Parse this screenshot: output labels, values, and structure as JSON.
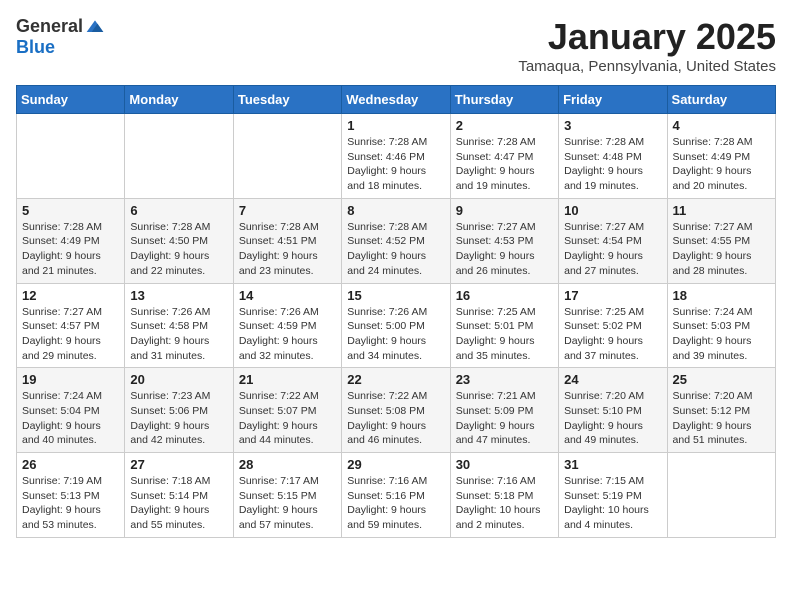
{
  "header": {
    "logo_general": "General",
    "logo_blue": "Blue",
    "month": "January 2025",
    "location": "Tamaqua, Pennsylvania, United States"
  },
  "weekdays": [
    "Sunday",
    "Monday",
    "Tuesday",
    "Wednesday",
    "Thursday",
    "Friday",
    "Saturday"
  ],
  "weeks": [
    [
      {
        "day": "",
        "info": ""
      },
      {
        "day": "",
        "info": ""
      },
      {
        "day": "",
        "info": ""
      },
      {
        "day": "1",
        "info": "Sunrise: 7:28 AM\nSunset: 4:46 PM\nDaylight: 9 hours\nand 18 minutes."
      },
      {
        "day": "2",
        "info": "Sunrise: 7:28 AM\nSunset: 4:47 PM\nDaylight: 9 hours\nand 19 minutes."
      },
      {
        "day": "3",
        "info": "Sunrise: 7:28 AM\nSunset: 4:48 PM\nDaylight: 9 hours\nand 19 minutes."
      },
      {
        "day": "4",
        "info": "Sunrise: 7:28 AM\nSunset: 4:49 PM\nDaylight: 9 hours\nand 20 minutes."
      }
    ],
    [
      {
        "day": "5",
        "info": "Sunrise: 7:28 AM\nSunset: 4:49 PM\nDaylight: 9 hours\nand 21 minutes."
      },
      {
        "day": "6",
        "info": "Sunrise: 7:28 AM\nSunset: 4:50 PM\nDaylight: 9 hours\nand 22 minutes."
      },
      {
        "day": "7",
        "info": "Sunrise: 7:28 AM\nSunset: 4:51 PM\nDaylight: 9 hours\nand 23 minutes."
      },
      {
        "day": "8",
        "info": "Sunrise: 7:28 AM\nSunset: 4:52 PM\nDaylight: 9 hours\nand 24 minutes."
      },
      {
        "day": "9",
        "info": "Sunrise: 7:27 AM\nSunset: 4:53 PM\nDaylight: 9 hours\nand 26 minutes."
      },
      {
        "day": "10",
        "info": "Sunrise: 7:27 AM\nSunset: 4:54 PM\nDaylight: 9 hours\nand 27 minutes."
      },
      {
        "day": "11",
        "info": "Sunrise: 7:27 AM\nSunset: 4:55 PM\nDaylight: 9 hours\nand 28 minutes."
      }
    ],
    [
      {
        "day": "12",
        "info": "Sunrise: 7:27 AM\nSunset: 4:57 PM\nDaylight: 9 hours\nand 29 minutes."
      },
      {
        "day": "13",
        "info": "Sunrise: 7:26 AM\nSunset: 4:58 PM\nDaylight: 9 hours\nand 31 minutes."
      },
      {
        "day": "14",
        "info": "Sunrise: 7:26 AM\nSunset: 4:59 PM\nDaylight: 9 hours\nand 32 minutes."
      },
      {
        "day": "15",
        "info": "Sunrise: 7:26 AM\nSunset: 5:00 PM\nDaylight: 9 hours\nand 34 minutes."
      },
      {
        "day": "16",
        "info": "Sunrise: 7:25 AM\nSunset: 5:01 PM\nDaylight: 9 hours\nand 35 minutes."
      },
      {
        "day": "17",
        "info": "Sunrise: 7:25 AM\nSunset: 5:02 PM\nDaylight: 9 hours\nand 37 minutes."
      },
      {
        "day": "18",
        "info": "Sunrise: 7:24 AM\nSunset: 5:03 PM\nDaylight: 9 hours\nand 39 minutes."
      }
    ],
    [
      {
        "day": "19",
        "info": "Sunrise: 7:24 AM\nSunset: 5:04 PM\nDaylight: 9 hours\nand 40 minutes."
      },
      {
        "day": "20",
        "info": "Sunrise: 7:23 AM\nSunset: 5:06 PM\nDaylight: 9 hours\nand 42 minutes."
      },
      {
        "day": "21",
        "info": "Sunrise: 7:22 AM\nSunset: 5:07 PM\nDaylight: 9 hours\nand 44 minutes."
      },
      {
        "day": "22",
        "info": "Sunrise: 7:22 AM\nSunset: 5:08 PM\nDaylight: 9 hours\nand 46 minutes."
      },
      {
        "day": "23",
        "info": "Sunrise: 7:21 AM\nSunset: 5:09 PM\nDaylight: 9 hours\nand 47 minutes."
      },
      {
        "day": "24",
        "info": "Sunrise: 7:20 AM\nSunset: 5:10 PM\nDaylight: 9 hours\nand 49 minutes."
      },
      {
        "day": "25",
        "info": "Sunrise: 7:20 AM\nSunset: 5:12 PM\nDaylight: 9 hours\nand 51 minutes."
      }
    ],
    [
      {
        "day": "26",
        "info": "Sunrise: 7:19 AM\nSunset: 5:13 PM\nDaylight: 9 hours\nand 53 minutes."
      },
      {
        "day": "27",
        "info": "Sunrise: 7:18 AM\nSunset: 5:14 PM\nDaylight: 9 hours\nand 55 minutes."
      },
      {
        "day": "28",
        "info": "Sunrise: 7:17 AM\nSunset: 5:15 PM\nDaylight: 9 hours\nand 57 minutes."
      },
      {
        "day": "29",
        "info": "Sunrise: 7:16 AM\nSunset: 5:16 PM\nDaylight: 9 hours\nand 59 minutes."
      },
      {
        "day": "30",
        "info": "Sunrise: 7:16 AM\nSunset: 5:18 PM\nDaylight: 10 hours\nand 2 minutes."
      },
      {
        "day": "31",
        "info": "Sunrise: 7:15 AM\nSunset: 5:19 PM\nDaylight: 10 hours\nand 4 minutes."
      },
      {
        "day": "",
        "info": ""
      }
    ]
  ]
}
